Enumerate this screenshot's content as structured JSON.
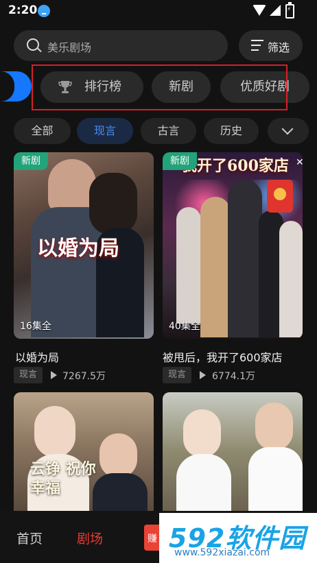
{
  "status_bar": {
    "time": "2:20"
  },
  "search": {
    "placeholder": "美乐剧场"
  },
  "filter": {
    "label": "筛选"
  },
  "rank_tabs": [
    {
      "label": "排行榜"
    },
    {
      "label": "新剧"
    },
    {
      "label": "优质好剧"
    }
  ],
  "categories": [
    {
      "label": "全部",
      "active": false
    },
    {
      "label": "现言",
      "active": true
    },
    {
      "label": "古言",
      "active": false
    },
    {
      "label": "历史",
      "active": false
    }
  ],
  "cards": [
    {
      "badge": "新剧",
      "episodes": "16集全",
      "poster_text": "以婚为局",
      "title": "以婚为局",
      "tag": "现言",
      "views": "7267.5万"
    },
    {
      "badge": "新剧",
      "episodes": "40集全",
      "poster_text": "我开了600家店",
      "title": "被甩后，我开了600家店",
      "tag": "现言",
      "views": "6774.1万"
    },
    {
      "poster_text": "云铮 祝你幸福"
    },
    {}
  ],
  "bottom_nav": {
    "home": "首页",
    "theater": "剧场",
    "earn": "赚"
  },
  "watermark": {
    "big": "592软件园",
    "small": "www.592xiazai.com"
  },
  "colors": {
    "accent_blue": "#1677ff",
    "accent_red": "#e53935",
    "badge_green": "#22a37a",
    "highlight_red": "#d6202a"
  }
}
